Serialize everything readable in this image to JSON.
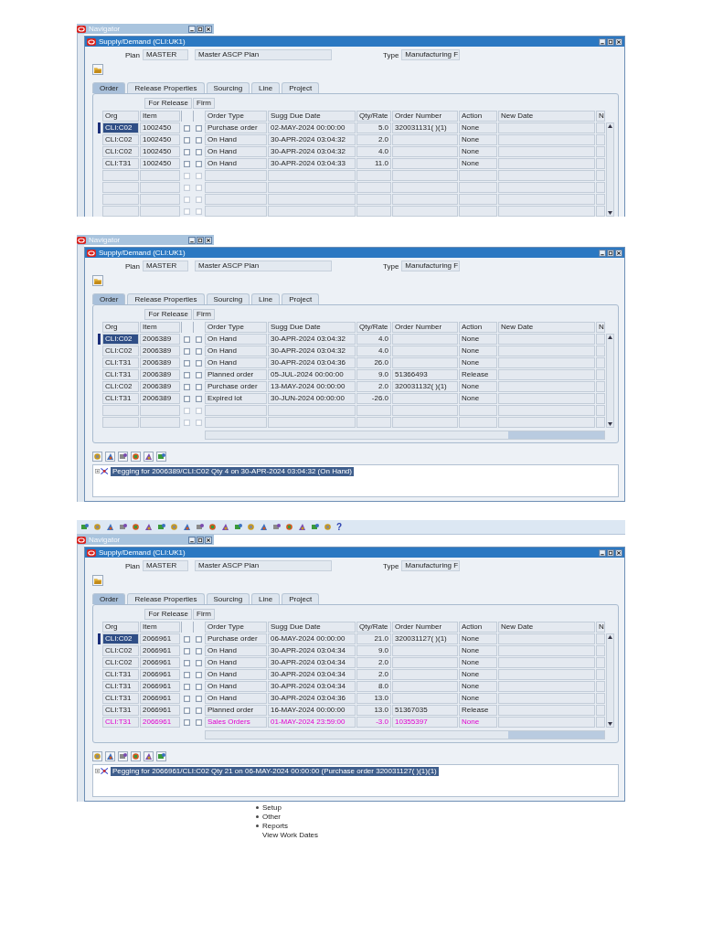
{
  "shots": [
    {
      "navigator_title": "Navigator",
      "window_title": "Supply/Demand (CLI:UK1)",
      "plan_label": "Plan",
      "plan": "MASTER",
      "plan_desc": "Master ASCP Plan",
      "type_label": "Type",
      "type": "Manufacturing F",
      "tabs": [
        {
          "label": "Order",
          "selected": true
        },
        {
          "label": "Release Properties",
          "selected": false
        },
        {
          "label": "Sourcing",
          "selected": false
        },
        {
          "label": "Line",
          "selected": false
        },
        {
          "label": "Project",
          "selected": false
        }
      ],
      "group_headers": [
        "For Release",
        "Firm"
      ],
      "columns": [
        "Org",
        "Item",
        "Order Type",
        "Sugg Due Date",
        "Qty/Rate",
        "Order Number",
        "Action",
        "New Date",
        "N"
      ],
      "rows": [
        {
          "org": "CLI:C02",
          "item": "1002450",
          "for_release": false,
          "firm": false,
          "order_type": "Purchase order",
          "sugg_due_date": "02-MAY-2024 00:00:00",
          "qty_rate": "5.0",
          "order_number": "320031131( )(1)",
          "action": "None",
          "selected": true,
          "highlighted": false
        },
        {
          "org": "CLI:C02",
          "item": "1002450",
          "for_release": false,
          "firm": false,
          "order_type": "On Hand",
          "sugg_due_date": "30-APR-2024 03:04:32",
          "qty_rate": "2.0",
          "action": "None",
          "selected": false,
          "highlighted": false
        },
        {
          "org": "CLI:C02",
          "item": "1002450",
          "for_release": false,
          "firm": false,
          "order_type": "On Hand",
          "sugg_due_date": "30-APR-2024 03:04:32",
          "qty_rate": "4.0",
          "action": "None",
          "selected": false,
          "highlighted": false
        },
        {
          "org": "CLI:T31",
          "item": "1002450",
          "for_release": false,
          "firm": false,
          "order_type": "On Hand",
          "sugg_due_date": "30-APR-2024 03:04:33",
          "qty_rate": "11.0",
          "action": "None",
          "selected": false,
          "highlighted": false
        },
        {
          "for_release": false,
          "firm": false,
          "selected": false
        },
        {
          "for_release": false,
          "firm": false,
          "selected": false
        },
        {
          "for_release": false,
          "firm": false,
          "selected": false
        },
        {
          "for_release": false,
          "firm": false,
          "selected": false
        }
      ]
    },
    {
      "navigator_title": "Navigator",
      "window_title": "Supply/Demand (CLI:UK1)",
      "plan_label": "Plan",
      "plan": "MASTER",
      "plan_desc": "Master ASCP Plan",
      "type_label": "Type",
      "type": "Manufacturing F",
      "tabs": [
        {
          "label": "Order",
          "selected": true
        },
        {
          "label": "Release Properties",
          "selected": false
        },
        {
          "label": "Sourcing",
          "selected": false
        },
        {
          "label": "Line",
          "selected": false
        },
        {
          "label": "Project",
          "selected": false
        }
      ],
      "group_headers": [
        "For Release",
        "Firm"
      ],
      "columns": [
        "Org",
        "Item",
        "Order Type",
        "Sugg Due Date",
        "Qty/Rate",
        "Order Number",
        "Action",
        "New Date",
        "N"
      ],
      "rows": [
        {
          "org": "CLI:C02",
          "item": "2006389",
          "for_release": false,
          "firm": false,
          "order_type": "On Hand",
          "sugg_due_date": "30-APR-2024 03:04:32",
          "qty_rate": "4.0",
          "action": "None",
          "selected": true,
          "highlighted": false
        },
        {
          "org": "CLI:C02",
          "item": "2006389",
          "for_release": false,
          "firm": false,
          "order_type": "On Hand",
          "sugg_due_date": "30-APR-2024 03:04:32",
          "qty_rate": "4.0",
          "action": "None",
          "selected": false,
          "highlighted": false
        },
        {
          "org": "CLI:T31",
          "item": "2006389",
          "for_release": false,
          "firm": false,
          "order_type": "On Hand",
          "sugg_due_date": "30-APR-2024 03:04:36",
          "qty_rate": "26.0",
          "action": "None",
          "selected": false,
          "highlighted": false
        },
        {
          "org": "CLI:T31",
          "item": "2006389",
          "for_release": false,
          "firm": false,
          "order_type": "Planned order",
          "sugg_due_date": "05-JUL-2024 00:00:00",
          "qty_rate": "9.0",
          "order_number": "51366493",
          "action": "Release",
          "selected": false,
          "highlighted": false
        },
        {
          "org": "CLI:C02",
          "item": "2006389",
          "for_release": false,
          "firm": false,
          "order_type": "Purchase order",
          "sugg_due_date": "13-MAY-2024 00:00:00",
          "qty_rate": "2.0",
          "order_number": "320031132( )(1)",
          "action": "None",
          "selected": false,
          "highlighted": false
        },
        {
          "org": "CLI:T31",
          "item": "2006389",
          "for_release": false,
          "firm": false,
          "order_type": "Expired lot",
          "sugg_due_date": "30-JUN-2024 00:00:00",
          "qty_rate": "-26.0",
          "action": "None",
          "selected": false,
          "highlighted": false
        },
        {
          "for_release": false,
          "firm": false,
          "selected": false
        },
        {
          "for_release": false,
          "firm": false,
          "selected": false
        }
      ],
      "pegging": "Pegging for 2006389/CLI:C02 Qty 4 on 30-APR-2024 03:04:32 (On Hand)"
    },
    {
      "toolbar_help": "?",
      "navigator_title": "Navigator",
      "window_title": "Supply/Demand (CLI:UK1)",
      "plan_label": "Plan",
      "plan": "MASTER",
      "plan_desc": "Master ASCP Plan",
      "type_label": "Type",
      "type": "Manufacturing F",
      "tabs": [
        {
          "label": "Order",
          "selected": true
        },
        {
          "label": "Release Properties",
          "selected": false
        },
        {
          "label": "Sourcing",
          "selected": false
        },
        {
          "label": "Line",
          "selected": false
        },
        {
          "label": "Project",
          "selected": false
        }
      ],
      "group_headers": [
        "For Release",
        "Firm"
      ],
      "columns": [
        "Org",
        "Item",
        "Order Type",
        "Sugg Due Date",
        "Qty/Rate",
        "Order Number",
        "Action",
        "New Date",
        "N"
      ],
      "rows": [
        {
          "org": "CLI:C02",
          "item": "2066961",
          "for_release": false,
          "firm": false,
          "order_type": "Purchase order",
          "sugg_due_date": "06-MAY-2024 00:00:00",
          "qty_rate": "21.0",
          "order_number": "320031127( )(1)",
          "action": "None",
          "selected": true,
          "highlighted": false
        },
        {
          "org": "CLI:C02",
          "item": "2066961",
          "for_release": false,
          "firm": false,
          "order_type": "On Hand",
          "sugg_due_date": "30-APR-2024 03:04:34",
          "qty_rate": "9.0",
          "action": "None",
          "selected": false,
          "highlighted": false
        },
        {
          "org": "CLI:C02",
          "item": "2066961",
          "for_release": false,
          "firm": false,
          "order_type": "On Hand",
          "sugg_due_date": "30-APR-2024 03:04:34",
          "qty_rate": "2.0",
          "action": "None",
          "selected": false,
          "highlighted": false
        },
        {
          "org": "CLI:T31",
          "item": "2066961",
          "for_release": false,
          "firm": false,
          "order_type": "On Hand",
          "sugg_due_date": "30-APR-2024 03:04:34",
          "qty_rate": "2.0",
          "action": "None",
          "selected": false,
          "highlighted": false
        },
        {
          "org": "CLI:T31",
          "item": "2066961",
          "for_release": false,
          "firm": false,
          "order_type": "On Hand",
          "sugg_due_date": "30-APR-2024 03:04:34",
          "qty_rate": "8.0",
          "action": "None",
          "selected": false,
          "highlighted": false
        },
        {
          "org": "CLI:T31",
          "item": "2066961",
          "for_release": false,
          "firm": false,
          "order_type": "On Hand",
          "sugg_due_date": "30-APR-2024 03:04:36",
          "qty_rate": "13.0",
          "action": "None",
          "selected": false,
          "highlighted": false
        },
        {
          "org": "CLI:T31",
          "item": "2066961",
          "for_release": false,
          "firm": false,
          "order_type": "Planned order",
          "sugg_due_date": "16-MAY-2024 00:00:00",
          "qty_rate": "13.0",
          "order_number": "51367035",
          "action": "Release",
          "selected": false,
          "highlighted": false
        },
        {
          "org": "CLI:T31",
          "item": "2066961",
          "for_release": false,
          "firm": false,
          "order_type": "Sales Orders",
          "sugg_due_date": "01-MAY-2024 23:59:00",
          "qty_rate": "-3.0",
          "order_number": "10355397",
          "action": "None",
          "selected": false,
          "highlighted": true
        }
      ],
      "pegging": "Pegging for 2066961/CLI:C02 Qty 21 on 06-MAY-2024 00:00:00 (Purchase order 320031127( )(1)(1)",
      "background_items": [
        {
          "label": "Setup",
          "bullet": true
        },
        {
          "label": "Other",
          "bullet": true
        },
        {
          "label": "Reports",
          "bullet": true
        },
        {
          "label": "View Work Dates",
          "bullet": false
        }
      ]
    }
  ]
}
